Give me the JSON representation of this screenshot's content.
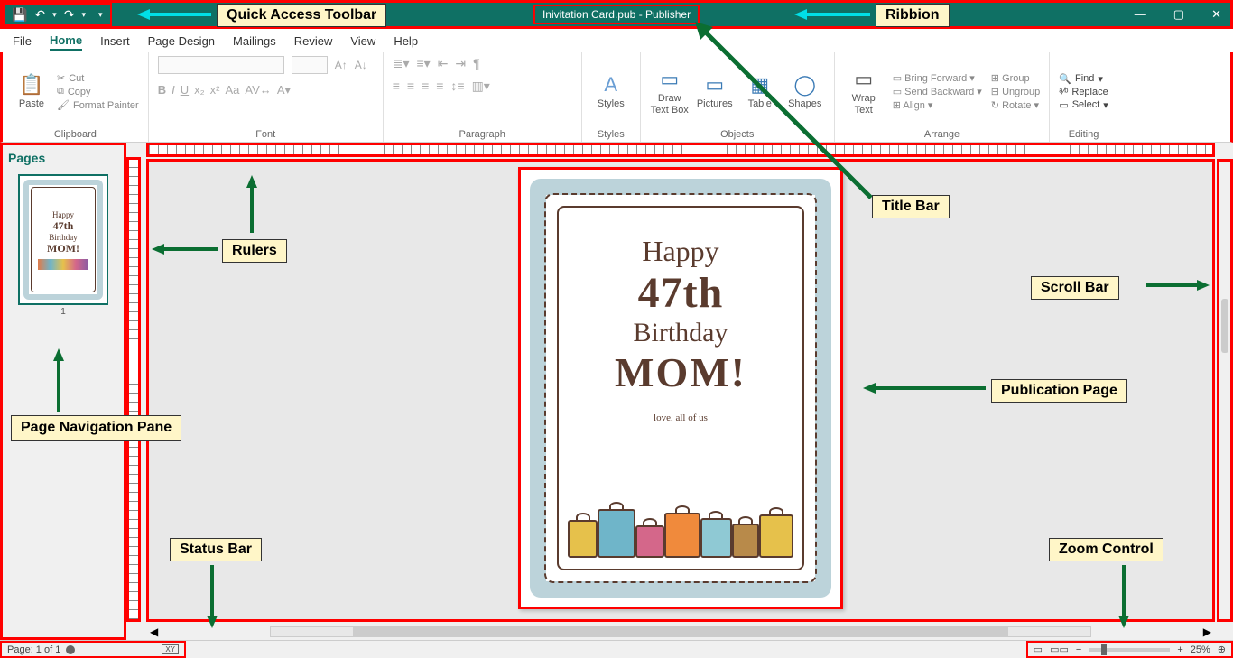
{
  "title": {
    "filename": "Inivitation Card.pub",
    "app": "Publisher"
  },
  "qat": {
    "save": "💾",
    "undo": "↶",
    "redo": "↷",
    "more": "▾"
  },
  "window": {
    "min": "—",
    "max": "▢",
    "close": "✕"
  },
  "tabs": [
    "File",
    "Home",
    "Insert",
    "Page Design",
    "Mailings",
    "Review",
    "View",
    "Help"
  ],
  "ribbon": {
    "clipboard": {
      "label": "Clipboard",
      "paste": "Paste",
      "cut": "Cut",
      "copy": "Copy",
      "fp": "Format Painter"
    },
    "font": {
      "label": "Font",
      "b": "B",
      "i": "I",
      "u": "U",
      "x2": "x₂",
      "x3": "x²",
      "aa": "Aa"
    },
    "paragraph": {
      "label": "Paragraph"
    },
    "styles": {
      "label": "Styles",
      "btn": "Styles"
    },
    "objects": {
      "label": "Objects",
      "draw": "Draw Text Box",
      "pictures": "Pictures",
      "table": "Table",
      "shapes": "Shapes"
    },
    "arrange": {
      "label": "Arrange",
      "wrap": "Wrap Text",
      "bf": "Bring Forward",
      "sb": "Send Backward",
      "align": "Align",
      "group": "Group",
      "ungroup": "Ungroup",
      "rotate": "Rotate"
    },
    "editing": {
      "label": "Editing",
      "find": "Find",
      "replace": "Replace",
      "select": "Select"
    }
  },
  "pages": {
    "title": "Pages",
    "pagenum": "1"
  },
  "card": {
    "l1": "Happy",
    "l2": "47th",
    "l3": "Birthday",
    "l4": "MOM!",
    "l5": "love, all of us"
  },
  "status": {
    "page": "Page: 1 of 1",
    "zoom": "25%",
    "plus": "+",
    "minus": "−"
  },
  "annotations": {
    "qat": "Quick Access Toolbar",
    "ribbon": "Ribbion",
    "titlebar": "Title Bar",
    "rulers": "Rulers",
    "scroll": "Scroll Bar",
    "pubpage": "Publication Page",
    "pagenav": "Page Navigation Pane",
    "statusbar": "Status Bar",
    "zoomctl": "Zoom Control"
  }
}
